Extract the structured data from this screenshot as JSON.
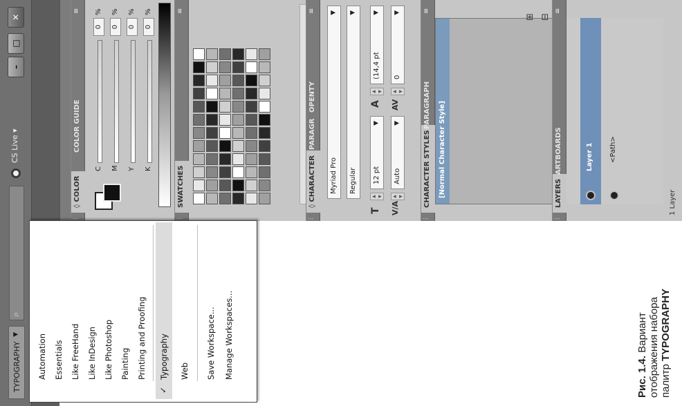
{
  "appbar": {
    "workspace_label": "TYPOGRAPHY",
    "search_icon": "search-icon",
    "cs_live_label": "CS Live",
    "window_buttons": [
      "minimize",
      "maximize",
      "close"
    ]
  },
  "workspace_menu": {
    "items": [
      {
        "label": "Automation"
      },
      {
        "label": "Essentials"
      },
      {
        "label": "Like FreeHand"
      },
      {
        "label": "Like InDesign"
      },
      {
        "label": "Like Photoshop"
      },
      {
        "label": "Painting"
      },
      {
        "label": "Printing and Proofing"
      },
      {
        "label": "Typography",
        "checked": true
      },
      {
        "label": "Web"
      }
    ],
    "actions": [
      {
        "label": "Save Workspace..."
      },
      {
        "label": "Manage Workspaces..."
      }
    ],
    "check_mark": "✓"
  },
  "color_panel": {
    "tabs": [
      "◊ COLOR",
      "COLOR GUIDE"
    ],
    "channels": [
      {
        "label": "C",
        "value": "0",
        "unit": "%"
      },
      {
        "label": "M",
        "value": "0",
        "unit": "%"
      },
      {
        "label": "Y",
        "value": "0",
        "unit": "%"
      },
      {
        "label": "K",
        "value": "0",
        "unit": "%"
      }
    ]
  },
  "swatches_panel": {
    "tab": "SWATCHES"
  },
  "character_panel": {
    "tabs": [
      "◊ CHARACTER",
      "PARAGR",
      "OPENTY"
    ],
    "font_family": "Myriad Pro",
    "font_style": "Regular",
    "font_size": "12 pt",
    "leading": "(14,4 pt",
    "kerning": "Auto",
    "tracking": "0"
  },
  "character_styles_panel": {
    "tabs": [
      "CHARACTER STYLES",
      "PARAGRAPH"
    ],
    "selected_style": "[Normal Character Style]"
  },
  "layers_panel": {
    "tabs": [
      "LAYERS",
      "ARTBOARDS"
    ],
    "layer_name": "Layer 1",
    "sublayer_name": "<Path>",
    "status": "1 Layer"
  },
  "caption": {
    "fig_label": "Рис. 1.4.",
    "line1": "Вариант",
    "line2": "отображения набора",
    "line3_prefix": "палитр",
    "line3_bold": "TYPOGRAPHY"
  }
}
